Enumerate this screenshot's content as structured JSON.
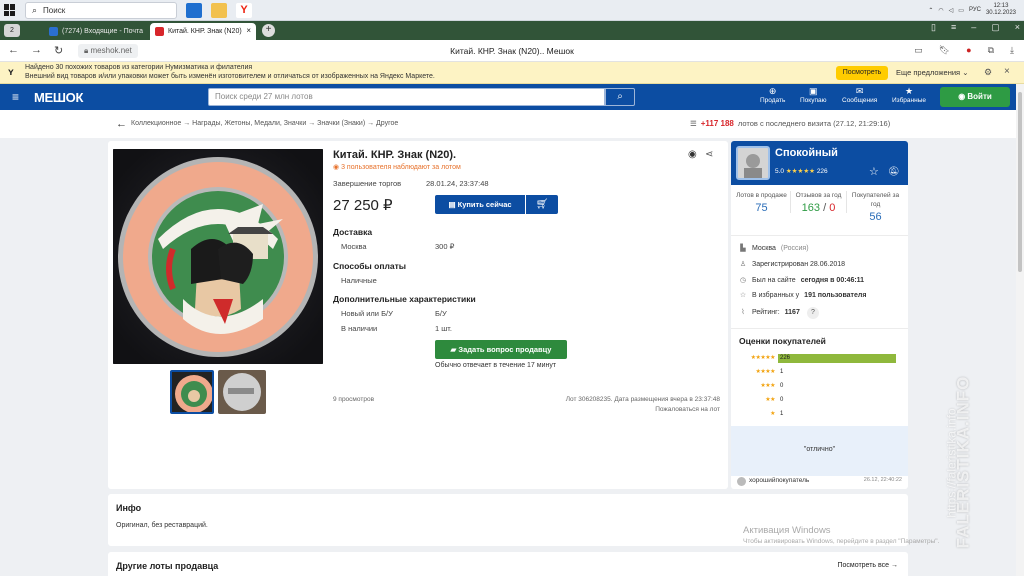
{
  "taskbar": {
    "search_placeholder": "Поиск",
    "lang": "РУС",
    "time": "12:13",
    "date": "30.12.2023"
  },
  "browser": {
    "tab_count": "2",
    "tabs": [
      {
        "label": "(7274) Входящие - Почта"
      },
      {
        "label": "Китай. КНР. Знак (N20)"
      }
    ],
    "url": "meshok.net",
    "title": "Китай. КНР. Знак (N20).. Мешок"
  },
  "infobar": {
    "line1": "Найдено 30 похожих товаров из категории Нумизматика и филателия",
    "line2": "Внешний вид товаров и/или упаковки может быть изменён изготовителем и отличаться от изображенных на Яндекс Маркете.",
    "look_label": "Посмотреть",
    "more_label": "Еще предложения"
  },
  "site": {
    "brand": "МЕШОК",
    "search_placeholder": "Поиск среди 27 млн лотов",
    "nav": [
      {
        "label": "Продать",
        "icon": "plus-icon"
      },
      {
        "label": "Покупаю",
        "icon": "bag-icon"
      },
      {
        "label": "Сообщения",
        "icon": "mail-icon"
      },
      {
        "label": "Избранные",
        "icon": "star-icon"
      }
    ],
    "login_label": "Войти"
  },
  "breadcrumbs": "Коллекционное → Награды, Жетоны, Медали, Значки → Значки (Знаки) → Другое",
  "visits": {
    "count": "+117 188",
    "text": "лотов с последнего визита (27.12, 21:29:16)"
  },
  "lot": {
    "title": "Китай. КНР. Знак (N20).",
    "watchers": "3 пользователя наблюдают за лотом",
    "end_label": "Завершение торгов",
    "end_value": "28.01.24, 23:37:48",
    "price": "27 250 ₽",
    "buy_label": "Купить сейчас",
    "delivery_title": "Доставка",
    "delivery_city": "Москва",
    "delivery_price": "300 ₽",
    "payment_title": "Способы оплаты",
    "payment_value": "Наличные",
    "extra_title": "Дополнительные характеристики",
    "cond_label": "Новый или Б/У",
    "cond_value": "Б/У",
    "stock_label": "В наличии",
    "stock_value": "1 шт.",
    "ask_label": "Задать вопрос продавцу",
    "reply_time": "Обычно отвечает в течение 17 минут",
    "views": "9 просмотров",
    "lot_info": "Лот 306208235. Дата размещения вчера в 23:37:48",
    "complain": "Пожаловаться на лот"
  },
  "seller": {
    "name": "Спокойный",
    "rating": "5.0",
    "reviews_count": "226",
    "stats": {
      "lots_label": "Лотов в продаже",
      "lots_value": "75",
      "reviews_label": "Отзывов за год",
      "reviews_pos": "163",
      "reviews_sep": "/",
      "reviews_neg": "0",
      "buyers_label": "Покупателей за год",
      "buyers_value": "56"
    },
    "city": "Москва",
    "country": "(Россия)",
    "registered": "Зарегистрирован 28.06.2018",
    "online_prefix": "Был на сайте",
    "online_value": "сегодня в 00:46:11",
    "fav_prefix": "В избранных у",
    "fav_value": "191 пользователя",
    "rating_label": "Рейтинг:",
    "rating_value": "1167",
    "help": "?",
    "ratings_title": "Оценки покупателей",
    "ratings": [
      {
        "stars": "★★★★★",
        "count": "226",
        "share": 1.0
      },
      {
        "stars": "★★★★",
        "count": "1",
        "share": 0.0
      },
      {
        "stars": "★★★",
        "count": "0",
        "share": 0.0
      },
      {
        "stars": "★★",
        "count": "0",
        "share": 0.0
      },
      {
        "stars": "★",
        "count": "1",
        "share": 0.0
      }
    ],
    "review_text": "\"отлично\"",
    "review_user": "хорошийпокупатель",
    "review_date": "26.12, 22:40:22"
  },
  "info": {
    "title": "Инфо",
    "text": "Оригинал, без реставраций."
  },
  "other": {
    "title": "Другие лоты продавца",
    "link": "Посмотреть все →"
  },
  "activation": {
    "line1": "Активация Windows",
    "line2": "Чтобы активировать Windows, перейдите в раздел \"Параметры\"."
  },
  "watermark": {
    "line1": "FALERISTIKA.INFO",
    "line2": "https://faleristika.info"
  },
  "colors": {
    "site_blue": "#0c4da2",
    "green": "#2e9b44",
    "accent_red": "#d8262b",
    "star": "#f2a30f"
  }
}
